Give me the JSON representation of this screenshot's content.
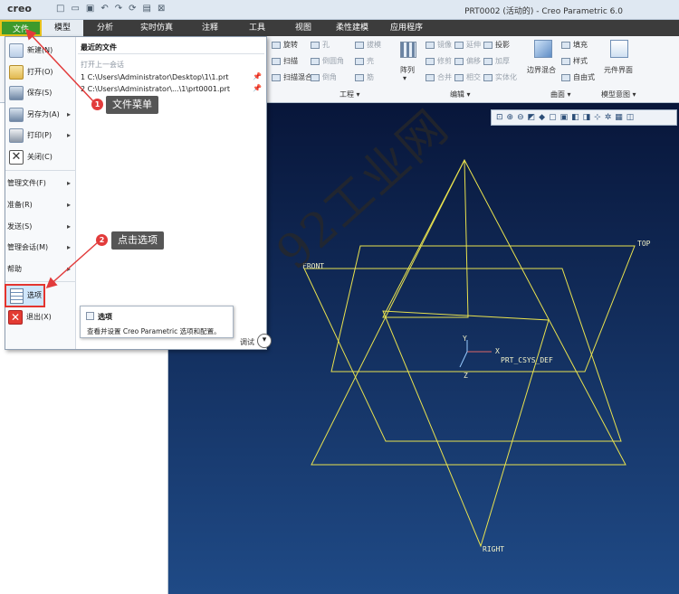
{
  "app": {
    "logo": "creo",
    "window_title": "PRT0002 (活动的) - Creo Parametric 6.0"
  },
  "menu_tabs": [
    "文件",
    "模型",
    "分析",
    "实时仿真",
    "注释",
    "工具",
    "视图",
    "柔性建模",
    "应用程序"
  ],
  "ribbon": {
    "shape_items": [
      "旋转",
      "扫描",
      "扫描混合"
    ],
    "engineering_items": [
      "孔",
      "倒圆角",
      "倒角",
      "拔模",
      "壳",
      "筋"
    ],
    "engineering_label": "工程",
    "edit_items": [
      "镜像",
      "修剪",
      "合并",
      "延伸",
      "偏移",
      "相交",
      "投影",
      "加厚",
      "实体化"
    ],
    "array_label": "阵列",
    "edit_label": "编辑",
    "surface_items": [
      "边界混合",
      "填充",
      "样式",
      "自由式"
    ],
    "surface_label": "曲面",
    "intent_item": "元件界面",
    "intent_label": "模型意图"
  },
  "file_menu": {
    "items": [
      {
        "label": "新建(N)",
        "arrow": ""
      },
      {
        "label": "打开(O)",
        "arrow": ""
      },
      {
        "label": "保存(S)",
        "arrow": ""
      },
      {
        "label": "另存为(A)",
        "arrow": "▸"
      },
      {
        "label": "打印(P)",
        "arrow": "▸"
      },
      {
        "label": "关闭(C)",
        "arrow": ""
      },
      {
        "label": "管理文件(F)",
        "arrow": "▸"
      },
      {
        "label": "准备(R)",
        "arrow": "▸"
      },
      {
        "label": "发送(S)",
        "arrow": "▸"
      },
      {
        "label": "管理会话(M)",
        "arrow": "▸"
      },
      {
        "label": "帮助",
        "arrow": "▸"
      },
      {
        "label": "选项",
        "arrow": ""
      },
      {
        "label": "退出(X)",
        "arrow": ""
      }
    ],
    "recent_title": "最近的文件",
    "recent_subtitle": "打开上一会话",
    "recent_files": [
      "1 C:\\Users\\Administrator\\Desktop\\1\\1.prt",
      "2 C:\\Users\\Administrator\\...\\1\\prt0001.prt"
    ],
    "bottom_label": "调试"
  },
  "tooltip": {
    "title": "选项",
    "description": "查看并设置 Creo Parametric 选项和配置。"
  },
  "callouts": {
    "badge1": "1",
    "text1": "文件菜单",
    "badge2": "2",
    "text2": "点击选项"
  },
  "datum": {
    "front": "FRONT",
    "top": "TOP",
    "right": "RIGHT",
    "csys": "PRT_CSYS_DEF",
    "x": "X",
    "y": "Y",
    "z": "Z"
  },
  "watermark": "92工业网"
}
